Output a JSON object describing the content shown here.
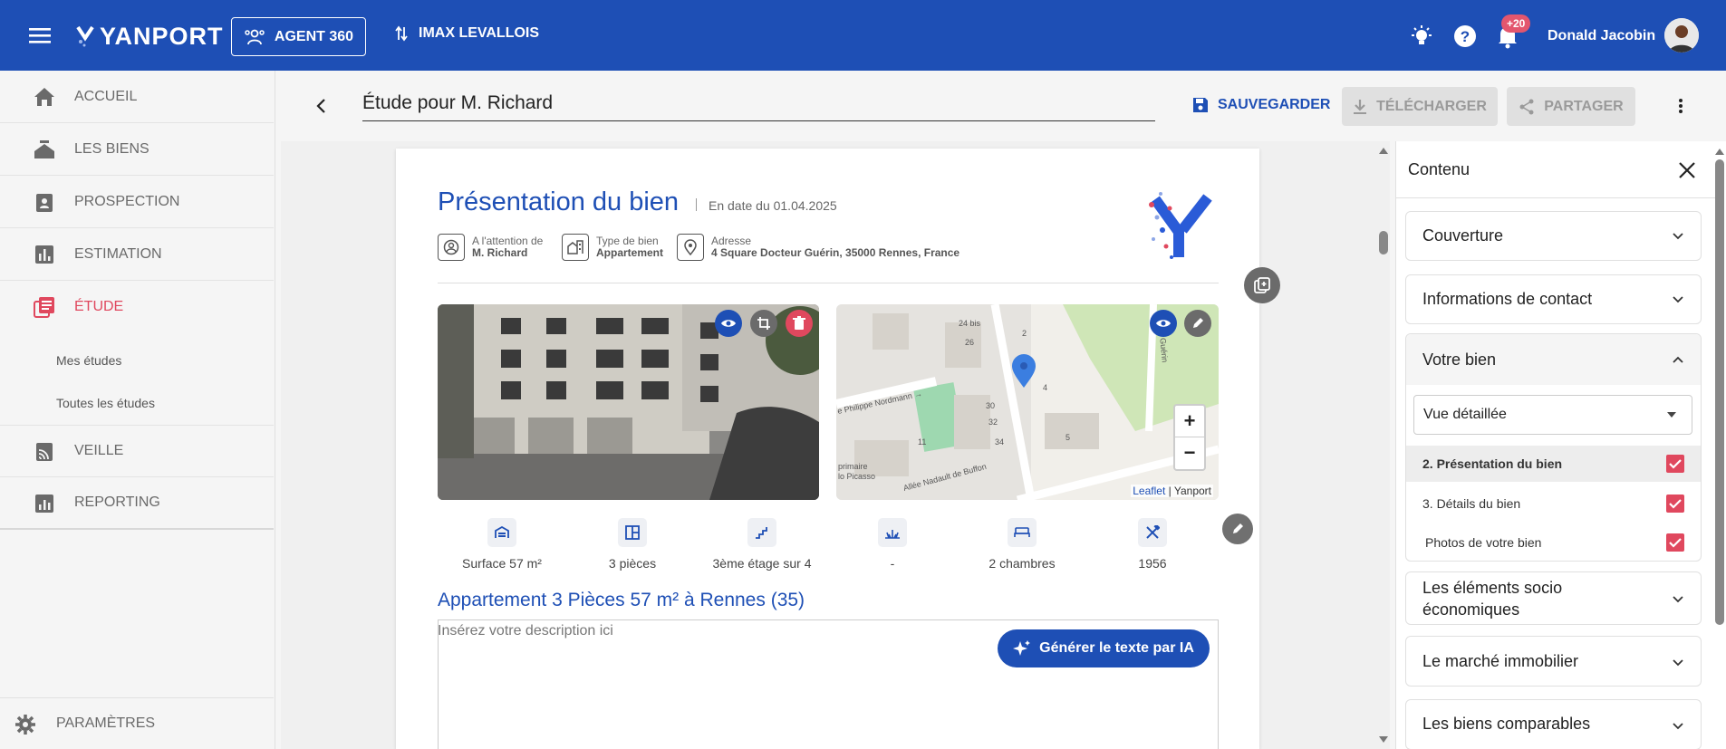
{
  "topbar": {
    "logo_text": "YANPORT",
    "agent_button": "AGENT 360",
    "agency": "IMAX LEVALLOIS",
    "notifications_badge": "+20",
    "user_name": "Donald Jacobin",
    "bg_color": "#1e4fb5"
  },
  "sidebar": {
    "items": [
      {
        "label": "ACCUEIL",
        "icon": "home-icon"
      },
      {
        "label": "LES BIENS",
        "icon": "house-stack-icon"
      },
      {
        "label": "PROSPECTION",
        "icon": "clipboard-user-icon"
      },
      {
        "label": "ESTIMATION",
        "icon": "bar-chart-icon"
      },
      {
        "label": "ÉTUDE",
        "icon": "study-doc-icon",
        "active": true
      },
      {
        "label": "VEILLE",
        "icon": "cast-icon"
      },
      {
        "label": "REPORTING",
        "icon": "report-chart-icon"
      }
    ],
    "sub_items": [
      "Mes études",
      "Toutes les études"
    ],
    "settings_label": "PARAMÈTRES",
    "active_color": "#e0485e"
  },
  "header": {
    "title_value": "Étude pour M. Richard",
    "save_label": "SAUVEGARDER",
    "download_label": "TÉLÉCHARGER",
    "share_label": "PARTAGER"
  },
  "document": {
    "title": "Présentation du bien",
    "date": "En date du 01.04.2025",
    "attention_label": "A l'attention de",
    "attention_value": "M. Richard",
    "type_label": "Type de bien",
    "type_value": "Appartement",
    "address_label": "Adresse",
    "address_value": "4 Square Docteur Guérin, 35000 Rennes, France",
    "map_attribution_leaflet": "Leaflet",
    "map_attribution_sep": " | ",
    "map_attribution_owner": "Yanport",
    "map_zoom_in": "+",
    "map_zoom_out": "−",
    "map_labels": {
      "street1": "e Philippe Nordmann →",
      "street2": "Allée Nadault de Buffon",
      "school": "primaire",
      "picasso": "lo Picasso",
      "guerin": "ncteur Guérin",
      "n24bis": "24 bis",
      "n26": "26",
      "n30": "30",
      "n32": "32",
      "n34": "34",
      "n11": "11",
      "n4": "4",
      "n5": "5",
      "n2": "2"
    },
    "features": [
      {
        "icon": "garage-icon",
        "label": "Surface 57 m²"
      },
      {
        "icon": "rooms-icon",
        "label": "3 pièces"
      },
      {
        "icon": "stairs-icon",
        "label": "3ème étage sur 4"
      },
      {
        "icon": "grass-icon",
        "label": "-"
      },
      {
        "icon": "bed-icon",
        "label": "2 chambres"
      },
      {
        "icon": "tools-icon",
        "label": "1956"
      }
    ],
    "ad_title": "Appartement 3 Pièces 57 m² à Rennes (35)",
    "description_placeholder": "Insérez votre description ici",
    "ai_button": "Générer le texte par IA"
  },
  "panel": {
    "title": "Contenu",
    "sections": [
      {
        "label": "Couverture",
        "expanded": false
      },
      {
        "label": "Informations de contact",
        "expanded": false
      },
      {
        "label": "Votre bien",
        "expanded": true
      },
      {
        "label": "Les éléments socio économiques",
        "expanded": false
      },
      {
        "label": "Le marché immobilier",
        "expanded": false
      },
      {
        "label": "Les biens comparables",
        "expanded": false
      }
    ],
    "view_select": "Vue détaillée",
    "checkbox_items": [
      {
        "label": "2. Présentation du bien",
        "checked": true
      },
      {
        "label": "3. Détails du bien",
        "checked": true
      },
      {
        "label": "Photos de votre bien",
        "checked": true
      }
    ],
    "checkbox_color": "#e0485e"
  }
}
